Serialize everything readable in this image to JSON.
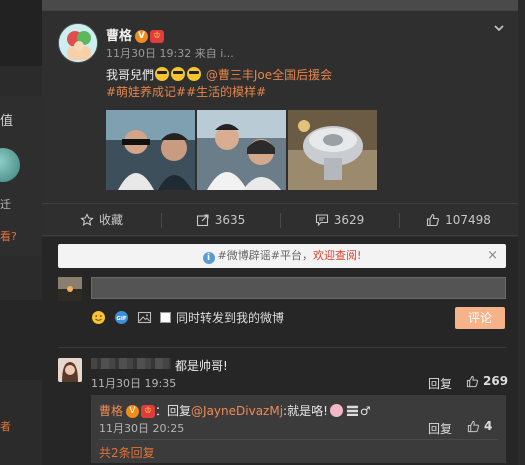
{
  "background": {
    "tag_text": "值",
    "side_text_1": "迁",
    "side_text_orange": "看?",
    "side_text_orange_2": "者"
  },
  "post": {
    "author": "曹格",
    "badge_v": "V",
    "badge_crown": "♔",
    "date": "11月30日 19:32",
    "source_prefix": "来自",
    "source_name": "i...",
    "text_prefix": "我哥兒們",
    "mention": "@曹三丰Joe全国后援会",
    "hashtags": "#萌娃养成记##生活的模样#",
    "menu_icon": "chevron-down-icon"
  },
  "actions": {
    "favorite_label": "收藏",
    "share_count": "3635",
    "comment_count": "3629",
    "like_count": "107498"
  },
  "notice": {
    "text_prefix": "#微博辟谣#平台，",
    "highlight": "欢迎查阅!",
    "close": "×"
  },
  "composer": {
    "input_value": "",
    "input_placeholder": "",
    "forward_label": "同时转发到我的微博",
    "submit_label": "评论"
  },
  "comments": [
    {
      "text": "都是帅哥!",
      "time": "11月30日 19:35",
      "reply_label": "回复",
      "likes": "269"
    }
  ],
  "reply": {
    "author": "曹格",
    "prefix": "：回复",
    "mention": "@JayneDivazMj",
    "text": ":就是咯!",
    "suffix": "♂",
    "time": "11月30日 20:25",
    "reply_label": "回复",
    "likes": "4",
    "more_label": "共2条回复"
  },
  "colors": {
    "accent_orange": "#e5844a",
    "submit_bg": "#f6b38a",
    "notice_highlight": "#e3412c",
    "panel_bg": "#2f2f2f"
  }
}
